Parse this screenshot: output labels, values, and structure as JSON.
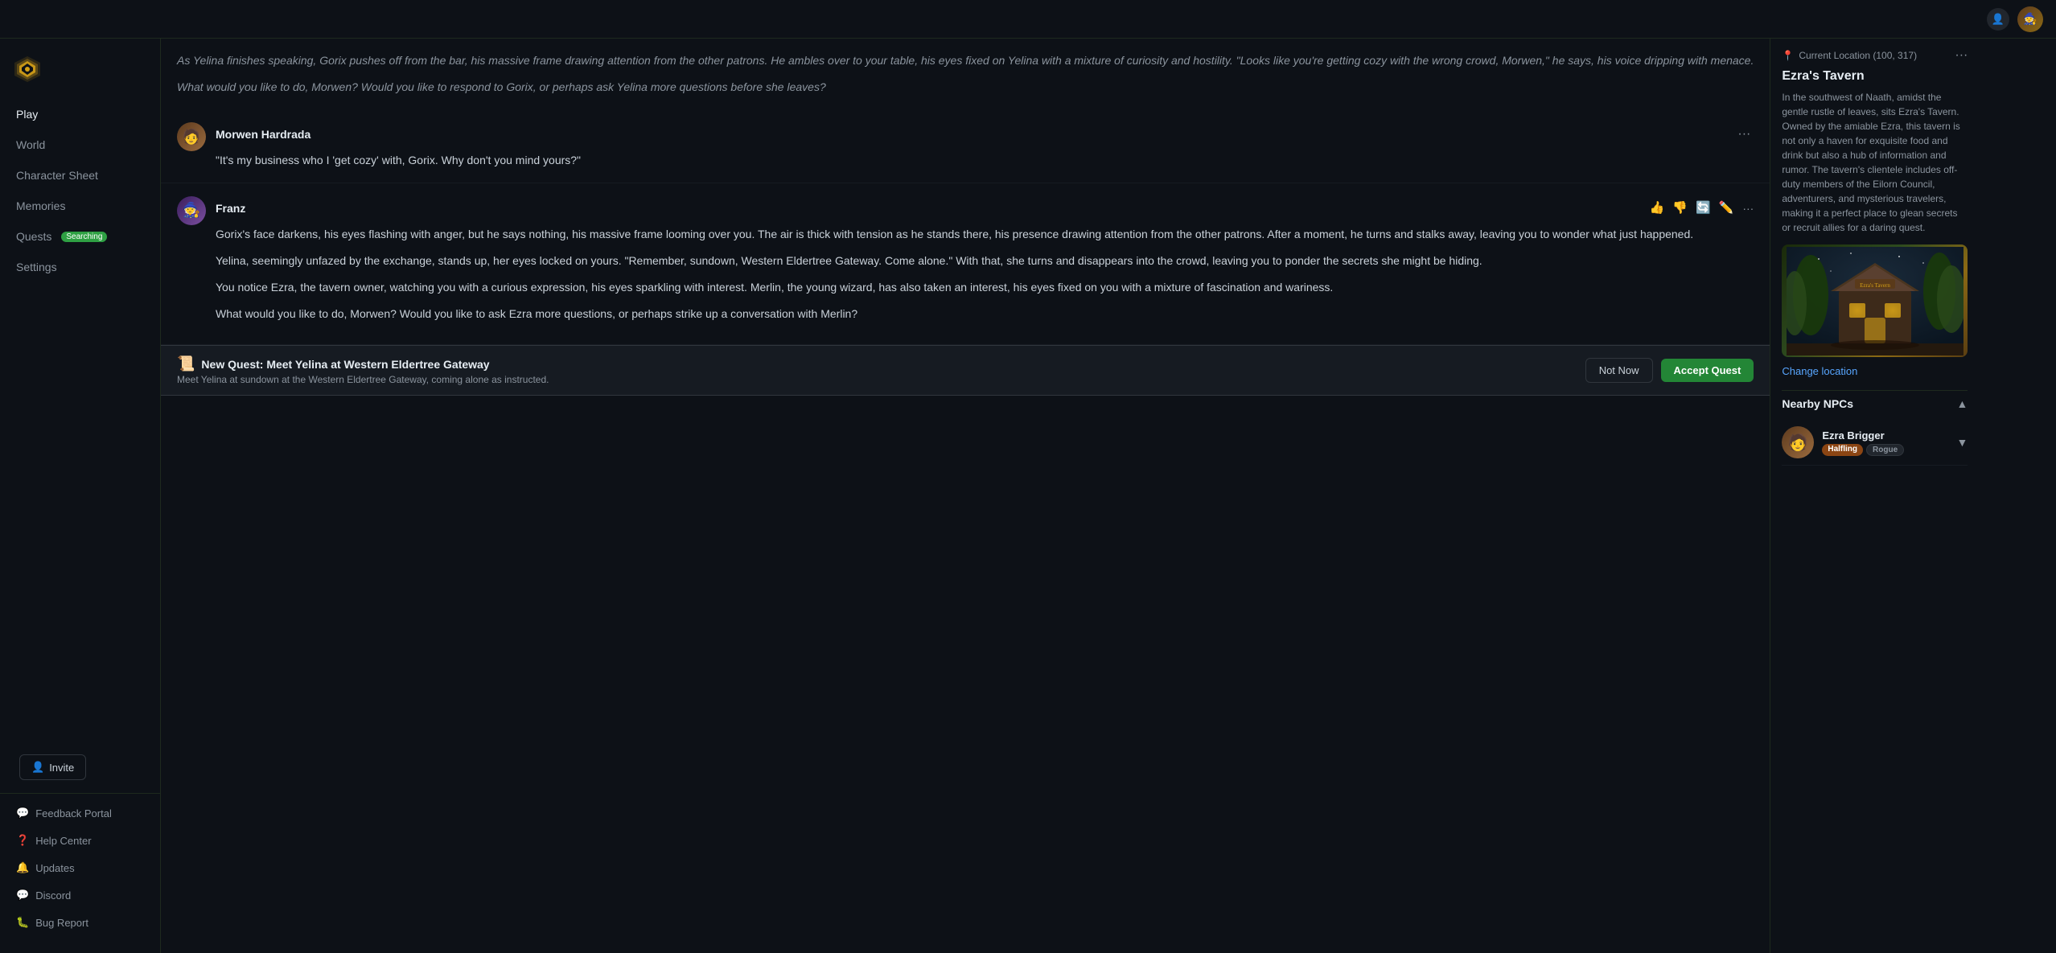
{
  "sidebar": {
    "logo_alt": "Game Logo",
    "nav_items": [
      {
        "id": "play",
        "label": "Play",
        "active": true
      },
      {
        "id": "world",
        "label": "World",
        "active": false
      },
      {
        "id": "character-sheet",
        "label": "Character Sheet",
        "active": false
      },
      {
        "id": "memories",
        "label": "Memories",
        "active": false
      },
      {
        "id": "quests",
        "label": "Quests",
        "badge": "Searching",
        "active": false
      },
      {
        "id": "settings",
        "label": "Settings",
        "active": false
      }
    ],
    "bottom_items": [
      {
        "id": "feedback-portal",
        "label": "Feedback Portal"
      },
      {
        "id": "help-center",
        "label": "Help Center"
      },
      {
        "id": "updates",
        "label": "Updates"
      },
      {
        "id": "discord",
        "label": "Discord"
      },
      {
        "id": "bug-report",
        "label": "Bug Report"
      }
    ],
    "invite_label": "Invite"
  },
  "chat": {
    "narrator_text": "As Yelina finishes speaking, Gorix pushes off from the bar, his massive frame drawing attention from the other patrons. He ambles over to your table, his eyes fixed on Yelina with a mixture of curiosity and hostility. \"Looks like you're getting cozy with the wrong crowd, Morwen,\" he says, his voice dripping with menace.",
    "narrator_question": "What would you like to do, Morwen? Would you like to respond to Gorix, or perhaps ask Yelina more questions before she leaves?",
    "messages": [
      {
        "id": "morwen",
        "author": "Morwen Hardrada",
        "avatar_color": "#5c3a1e",
        "text": "\"It's my business who I 'get cozy' with, Gorix. Why don't you mind yours?\""
      },
      {
        "id": "franz",
        "author": "Franz",
        "avatar_color": "#3a1e5c",
        "paragraphs": [
          "Gorix's face darkens, his eyes flashing with anger, but he says nothing, his massive frame looming over you. The air is thick with tension as he stands there, his presence drawing attention from the other patrons. After a moment, he turns and stalks away, leaving you to wonder what just happened.",
          "Yelina, seemingly unfazed by the exchange, stands up, her eyes locked on yours. \"Remember, sundown, Western Eldertree Gateway. Come alone.\" With that, she turns and disappears into the crowd, leaving you to ponder the secrets she might be hiding.",
          "You notice Ezra, the tavern owner, watching you with a curious expression, his eyes sparkling with interest. Merlin, the young wizard, has also taken an interest, his eyes fixed on you with a mixture of fascination and wariness.",
          "What would you like to do, Morwen? Would you like to ask Ezra more questions, or perhaps strike up a conversation with Merlin?"
        ]
      }
    ],
    "quest": {
      "icon": "📜",
      "title": "New Quest: Meet Yelina at Western Eldertree Gateway",
      "subtitle": "Meet Yelina at sundown at the Western Eldertree Gateway, coming alone as instructed.",
      "btn_not_now": "Not Now",
      "btn_accept": "Accept Quest"
    }
  },
  "right_sidebar": {
    "current_location_label": "Current Location (100, 317)",
    "location_name": "Ezra's Tavern",
    "location_description": "In the southwest of Naath, amidst the gentle rustle of leaves, sits Ezra's Tavern. Owned by the amiable Ezra, this tavern is not only a haven for exquisite food and drink but also a hub of information and rumor. The tavern's clientele includes off-duty members of the Eilorn Council, adventurers, and mysterious travelers, making it a perfect place to glean secrets or recruit allies for a daring quest.",
    "change_location_label": "Change location",
    "nearby_npcs_label": "Nearby NPCs",
    "npcs": [
      {
        "id": "ezra-brigger",
        "name": "Ezra Brigger",
        "tags": [
          "Halfling",
          "Rogue"
        ]
      }
    ]
  }
}
